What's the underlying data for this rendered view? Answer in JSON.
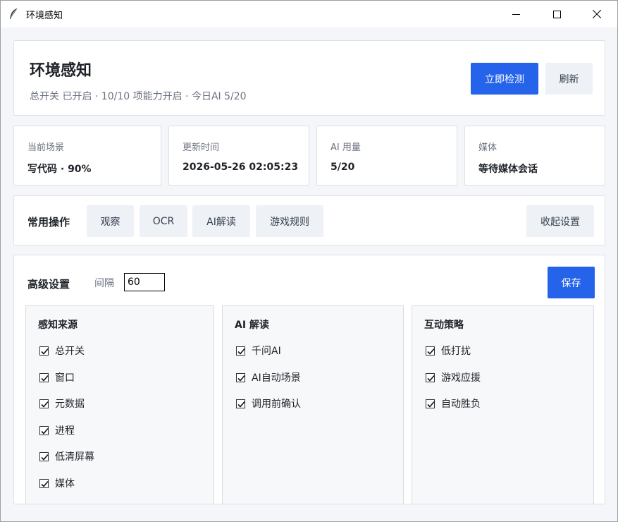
{
  "window": {
    "title": "环境感知"
  },
  "header": {
    "title": "环境感知",
    "subtitle": "总开关 已开启 · 10/10 项能力开启 · 今日AI 5/20",
    "detect_label": "立即检测",
    "refresh_label": "刷新"
  },
  "stats": [
    {
      "label": "当前场景",
      "value": "写代码 · 90%"
    },
    {
      "label": "更新时间",
      "value": "2026-05-26 02:05:23"
    },
    {
      "label": "AI 用量",
      "value": "5/20"
    },
    {
      "label": "媒体",
      "value": "等待媒体会话"
    }
  ],
  "actions": {
    "title": "常用操作",
    "buttons": [
      "观察",
      "OCR",
      "AI解读",
      "游戏规则"
    ],
    "collapse_label": "收起设置"
  },
  "settings": {
    "title": "高级设置",
    "interval_label": "间隔",
    "interval_value": "60",
    "save_label": "保存",
    "groups": [
      {
        "title": "感知来源",
        "options": [
          {
            "label": "总开关",
            "checked": true
          },
          {
            "label": "窗口",
            "checked": true
          },
          {
            "label": "元数据",
            "checked": true
          },
          {
            "label": "进程",
            "checked": true
          },
          {
            "label": "低清屏幕",
            "checked": true
          },
          {
            "label": "媒体",
            "checked": true
          }
        ]
      },
      {
        "title": "AI 解读",
        "options": [
          {
            "label": "千问AI",
            "checked": true
          },
          {
            "label": "AI自动场景",
            "checked": true
          },
          {
            "label": "调用前确认",
            "checked": true
          }
        ]
      },
      {
        "title": "互动策略",
        "options": [
          {
            "label": "低打扰",
            "checked": true
          },
          {
            "label": "游戏应援",
            "checked": true
          },
          {
            "label": "自动胜负",
            "checked": true
          }
        ]
      }
    ]
  },
  "colors": {
    "accent": "#2563eb",
    "light_button": "#eef1f5",
    "background": "#f4f6f9"
  }
}
